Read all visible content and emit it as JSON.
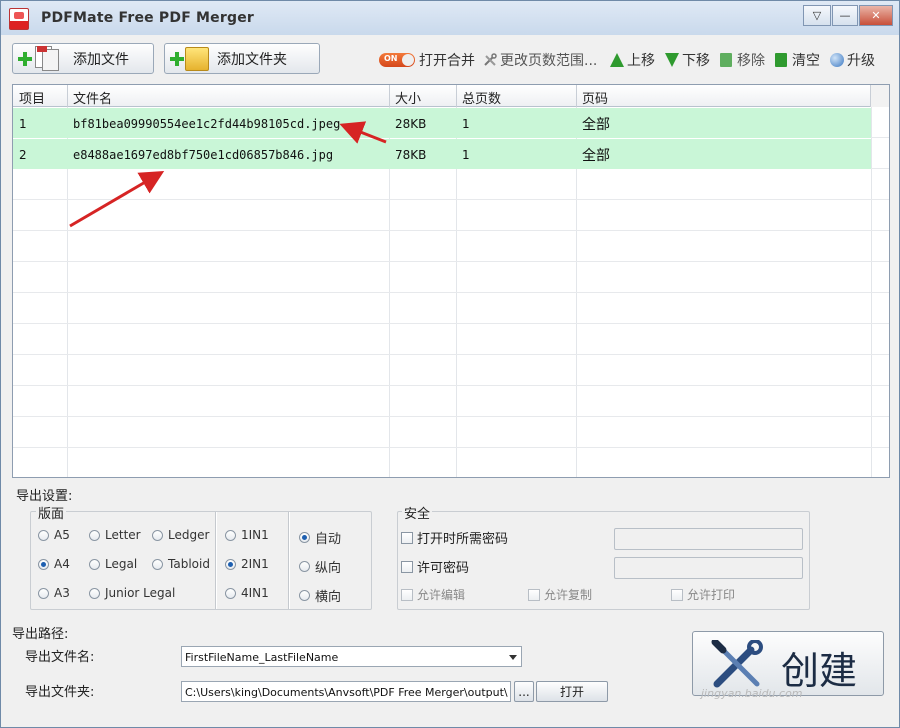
{
  "window": {
    "title": "PDFMate Free PDF Merger"
  },
  "title_buttons": {
    "dropdown": "▽",
    "minimize": "—",
    "close": "✕"
  },
  "toolbar": {
    "add_file": "添加文件",
    "add_folder": "添加文件夹",
    "toggle_text": "ON",
    "open_merge": "打开合并",
    "change_range": "更改页数范围...",
    "move_up": "上移",
    "move_down": "下移",
    "remove": "移除",
    "clear": "清空",
    "upgrade": "升级"
  },
  "table": {
    "headers": [
      "项目",
      "文件名",
      "大小",
      "总页数",
      "页码"
    ],
    "rows": [
      {
        "index": "1",
        "filename": "bf81bea09990554ee1c2fd44b98105cd.jpeg",
        "size": "28KB",
        "pages": "1",
        "range": "全部"
      },
      {
        "index": "2",
        "filename": "e8488ae1697ed8bf750e1cd06857b846.jpg",
        "size": "78KB",
        "pages": "1",
        "range": "全部"
      }
    ]
  },
  "export_settings": {
    "label": "导出设置:",
    "layout_title": "版面",
    "paper": [
      "A5",
      "Letter",
      "Ledger",
      "A4",
      "Legal",
      "Tabloid",
      "A3",
      "Junior Legal"
    ],
    "paper_selected": "A4",
    "nup": [
      "1IN1",
      "2IN1",
      "4IN1"
    ],
    "nup_selected": "2IN1",
    "orientation": [
      "自动",
      "纵向",
      "横向"
    ],
    "orientation_selected": "自动"
  },
  "security": {
    "title": "安全",
    "open_password": "打开时所需密码",
    "permission_password": "许可密码",
    "allow_edit": "允许编辑",
    "allow_copy": "允许复制",
    "allow_print": "允许打印"
  },
  "output": {
    "label": "导出路径:",
    "filename_label": "导出文件名:",
    "filename_value": "FirstFileName_LastFileName",
    "folder_label": "导出文件夹:",
    "folder_value": "C:\\Users\\king\\Documents\\Anvsoft\\PDF Free Merger\\output\\",
    "browse": "...",
    "open": "打开"
  },
  "create_button": "创建",
  "watermark": "jingyan.baidu.com",
  "colors": {
    "selected_row": "#c9f6d7",
    "toggle": "#e45a25",
    "arrow": "#d62424",
    "green_icon": "#2fae2f"
  }
}
